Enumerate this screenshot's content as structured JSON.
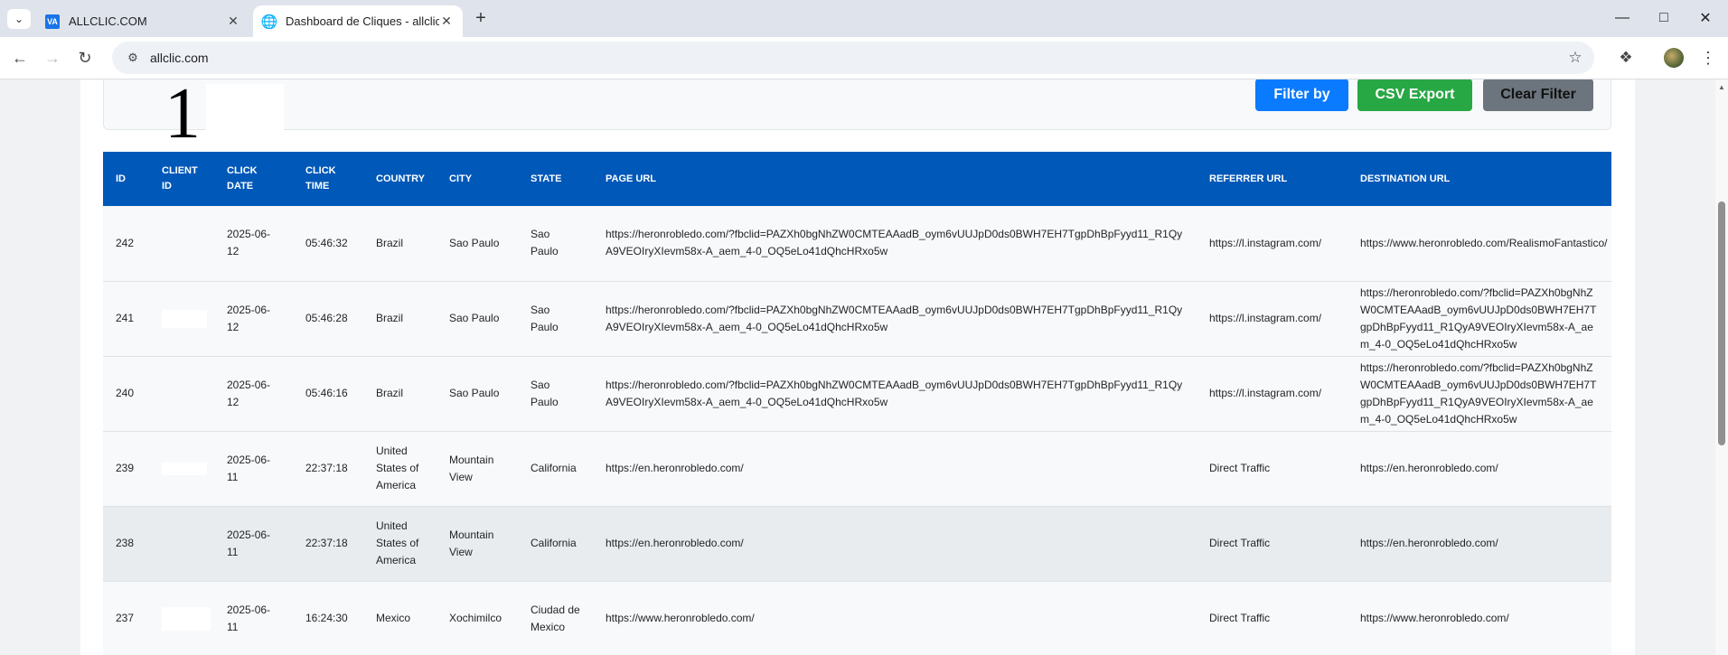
{
  "browser": {
    "tabs": [
      {
        "title": "ALLCLIC.COM",
        "favicon": "VA"
      },
      {
        "title": "Dashboard de Cliques - allclic"
      }
    ],
    "url": "allclic.com"
  },
  "filter": {
    "big_number": "1",
    "buttons": {
      "filter": "Filter by",
      "csv": "CSV Export",
      "clear": "Clear Filter"
    }
  },
  "colors": {
    "header": "#0058b8",
    "filter_btn": "#0a7bff",
    "csv_btn": "#28a745",
    "clear_btn": "#6c757d"
  },
  "table": {
    "headers": [
      "ID",
      "CLIENT ID",
      "CLICK DATE",
      "CLICK TIME",
      "COUNTRY",
      "CITY",
      "STATE",
      "PAGE URL",
      "REFERRER URL",
      "DESTINATION URL"
    ],
    "rows": [
      {
        "id": "242",
        "client_id": "",
        "date": "2025-06-12",
        "time": "05:46:32",
        "country": "Brazil",
        "city": "Sao Paulo",
        "state": "Sao Paulo",
        "page_url": "https://heronrobledo.com/?fbclid=PAZXh0bgNhZW0CMTEAAadB_oym6vUUJpD0ds0BWH7EH7TgpDhBpFyyd11_R1QyA9VEOIryXIevm58x-A_aem_4-0_OQ5eLo41dQhcHRxo5w",
        "referrer": "https://l.instagram.com/",
        "destination": "https://www.heronrobledo.com/RealismoFantastico/"
      },
      {
        "id": "241",
        "client_id": "",
        "date": "2025-06-12",
        "time": "05:46:28",
        "country": "Brazil",
        "city": "Sao Paulo",
        "state": "Sao Paulo",
        "page_url": "https://heronrobledo.com/?fbclid=PAZXh0bgNhZW0CMTEAAadB_oym6vUUJpD0ds0BWH7EH7TgpDhBpFyyd11_R1QyA9VEOIryXIevm58x-A_aem_4-0_OQ5eLo41dQhcHRxo5w",
        "referrer": "https://l.instagram.com/",
        "destination": "https://heronrobledo.com/?fbclid=PAZXh0bgNhZW0CMTEAAadB_oym6vUUJpD0ds0BWH7EH7TgpDhBpFyyd11_R1QyA9VEOIryXIevm58x-A_aem_4-0_OQ5eLo41dQhcHRxo5w"
      },
      {
        "id": "240",
        "client_id": "",
        "date": "2025-06-12",
        "time": "05:46:16",
        "country": "Brazil",
        "city": "Sao Paulo",
        "state": "Sao Paulo",
        "page_url": "https://heronrobledo.com/?fbclid=PAZXh0bgNhZW0CMTEAAadB_oym6vUUJpD0ds0BWH7EH7TgpDhBpFyyd11_R1QyA9VEOIryXIevm58x-A_aem_4-0_OQ5eLo41dQhcHRxo5w",
        "referrer": "https://l.instagram.com/",
        "destination": "https://heronrobledo.com/?fbclid=PAZXh0bgNhZW0CMTEAAadB_oym6vUUJpD0ds0BWH7EH7TgpDhBpFyyd11_R1QyA9VEOIryXIevm58x-A_aem_4-0_OQ5eLo41dQhcHRxo5w"
      },
      {
        "id": "239",
        "client_id": "",
        "date": "2025-06-11",
        "time": "22:37:18",
        "country": "United States of America",
        "city": "Mountain View",
        "state": "California",
        "page_url": "https://en.heronrobledo.com/",
        "referrer": "Direct Traffic",
        "destination": "https://en.heronrobledo.com/"
      },
      {
        "id": "238",
        "client_id": "",
        "date": "2025-06-11",
        "time": "22:37:18",
        "country": "United States of America",
        "city": "Mountain View",
        "state": "California",
        "page_url": "https://en.heronrobledo.com/",
        "referrer": "Direct Traffic",
        "destination": "https://en.heronrobledo.com/"
      },
      {
        "id": "237",
        "client_id": "",
        "date": "2025-06-11",
        "time": "16:24:30",
        "country": "Mexico",
        "city": "Xochimilco",
        "state": "Ciudad de Mexico",
        "page_url": "https://www.heronrobledo.com/",
        "referrer": "Direct Traffic",
        "destination": "https://www.heronrobledo.com/"
      }
    ]
  }
}
